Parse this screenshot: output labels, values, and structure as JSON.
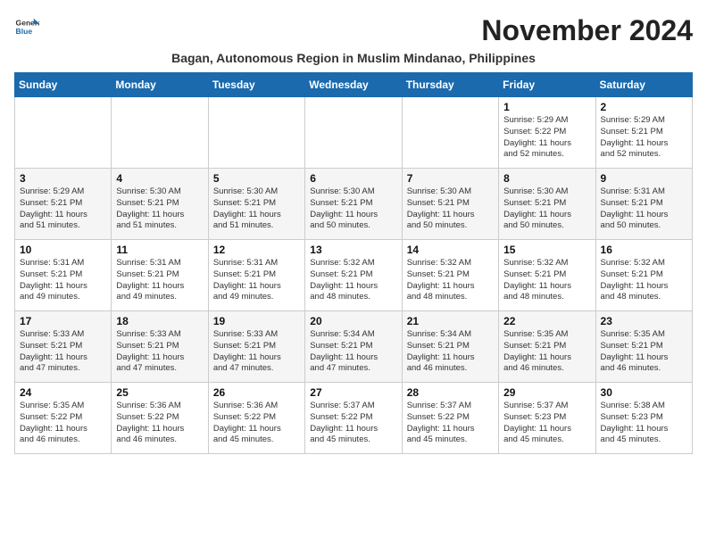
{
  "header": {
    "logo_line1": "General",
    "logo_line2": "Blue",
    "month_title": "November 2024",
    "subtitle": "Bagan, Autonomous Region in Muslim Mindanao, Philippines"
  },
  "days_of_week": [
    "Sunday",
    "Monday",
    "Tuesday",
    "Wednesday",
    "Thursday",
    "Friday",
    "Saturday"
  ],
  "weeks": [
    [
      {
        "day": "",
        "info": ""
      },
      {
        "day": "",
        "info": ""
      },
      {
        "day": "",
        "info": ""
      },
      {
        "day": "",
        "info": ""
      },
      {
        "day": "",
        "info": ""
      },
      {
        "day": "1",
        "info": "Sunrise: 5:29 AM\nSunset: 5:22 PM\nDaylight: 11 hours\nand 52 minutes."
      },
      {
        "day": "2",
        "info": "Sunrise: 5:29 AM\nSunset: 5:21 PM\nDaylight: 11 hours\nand 52 minutes."
      }
    ],
    [
      {
        "day": "3",
        "info": "Sunrise: 5:29 AM\nSunset: 5:21 PM\nDaylight: 11 hours\nand 51 minutes."
      },
      {
        "day": "4",
        "info": "Sunrise: 5:30 AM\nSunset: 5:21 PM\nDaylight: 11 hours\nand 51 minutes."
      },
      {
        "day": "5",
        "info": "Sunrise: 5:30 AM\nSunset: 5:21 PM\nDaylight: 11 hours\nand 51 minutes."
      },
      {
        "day": "6",
        "info": "Sunrise: 5:30 AM\nSunset: 5:21 PM\nDaylight: 11 hours\nand 50 minutes."
      },
      {
        "day": "7",
        "info": "Sunrise: 5:30 AM\nSunset: 5:21 PM\nDaylight: 11 hours\nand 50 minutes."
      },
      {
        "day": "8",
        "info": "Sunrise: 5:30 AM\nSunset: 5:21 PM\nDaylight: 11 hours\nand 50 minutes."
      },
      {
        "day": "9",
        "info": "Sunrise: 5:31 AM\nSunset: 5:21 PM\nDaylight: 11 hours\nand 50 minutes."
      }
    ],
    [
      {
        "day": "10",
        "info": "Sunrise: 5:31 AM\nSunset: 5:21 PM\nDaylight: 11 hours\nand 49 minutes."
      },
      {
        "day": "11",
        "info": "Sunrise: 5:31 AM\nSunset: 5:21 PM\nDaylight: 11 hours\nand 49 minutes."
      },
      {
        "day": "12",
        "info": "Sunrise: 5:31 AM\nSunset: 5:21 PM\nDaylight: 11 hours\nand 49 minutes."
      },
      {
        "day": "13",
        "info": "Sunrise: 5:32 AM\nSunset: 5:21 PM\nDaylight: 11 hours\nand 48 minutes."
      },
      {
        "day": "14",
        "info": "Sunrise: 5:32 AM\nSunset: 5:21 PM\nDaylight: 11 hours\nand 48 minutes."
      },
      {
        "day": "15",
        "info": "Sunrise: 5:32 AM\nSunset: 5:21 PM\nDaylight: 11 hours\nand 48 minutes."
      },
      {
        "day": "16",
        "info": "Sunrise: 5:32 AM\nSunset: 5:21 PM\nDaylight: 11 hours\nand 48 minutes."
      }
    ],
    [
      {
        "day": "17",
        "info": "Sunrise: 5:33 AM\nSunset: 5:21 PM\nDaylight: 11 hours\nand 47 minutes."
      },
      {
        "day": "18",
        "info": "Sunrise: 5:33 AM\nSunset: 5:21 PM\nDaylight: 11 hours\nand 47 minutes."
      },
      {
        "day": "19",
        "info": "Sunrise: 5:33 AM\nSunset: 5:21 PM\nDaylight: 11 hours\nand 47 minutes."
      },
      {
        "day": "20",
        "info": "Sunrise: 5:34 AM\nSunset: 5:21 PM\nDaylight: 11 hours\nand 47 minutes."
      },
      {
        "day": "21",
        "info": "Sunrise: 5:34 AM\nSunset: 5:21 PM\nDaylight: 11 hours\nand 46 minutes."
      },
      {
        "day": "22",
        "info": "Sunrise: 5:35 AM\nSunset: 5:21 PM\nDaylight: 11 hours\nand 46 minutes."
      },
      {
        "day": "23",
        "info": "Sunrise: 5:35 AM\nSunset: 5:21 PM\nDaylight: 11 hours\nand 46 minutes."
      }
    ],
    [
      {
        "day": "24",
        "info": "Sunrise: 5:35 AM\nSunset: 5:22 PM\nDaylight: 11 hours\nand 46 minutes."
      },
      {
        "day": "25",
        "info": "Sunrise: 5:36 AM\nSunset: 5:22 PM\nDaylight: 11 hours\nand 46 minutes."
      },
      {
        "day": "26",
        "info": "Sunrise: 5:36 AM\nSunset: 5:22 PM\nDaylight: 11 hours\nand 45 minutes."
      },
      {
        "day": "27",
        "info": "Sunrise: 5:37 AM\nSunset: 5:22 PM\nDaylight: 11 hours\nand 45 minutes."
      },
      {
        "day": "28",
        "info": "Sunrise: 5:37 AM\nSunset: 5:22 PM\nDaylight: 11 hours\nand 45 minutes."
      },
      {
        "day": "29",
        "info": "Sunrise: 5:37 AM\nSunset: 5:23 PM\nDaylight: 11 hours\nand 45 minutes."
      },
      {
        "day": "30",
        "info": "Sunrise: 5:38 AM\nSunset: 5:23 PM\nDaylight: 11 hours\nand 45 minutes."
      }
    ]
  ]
}
